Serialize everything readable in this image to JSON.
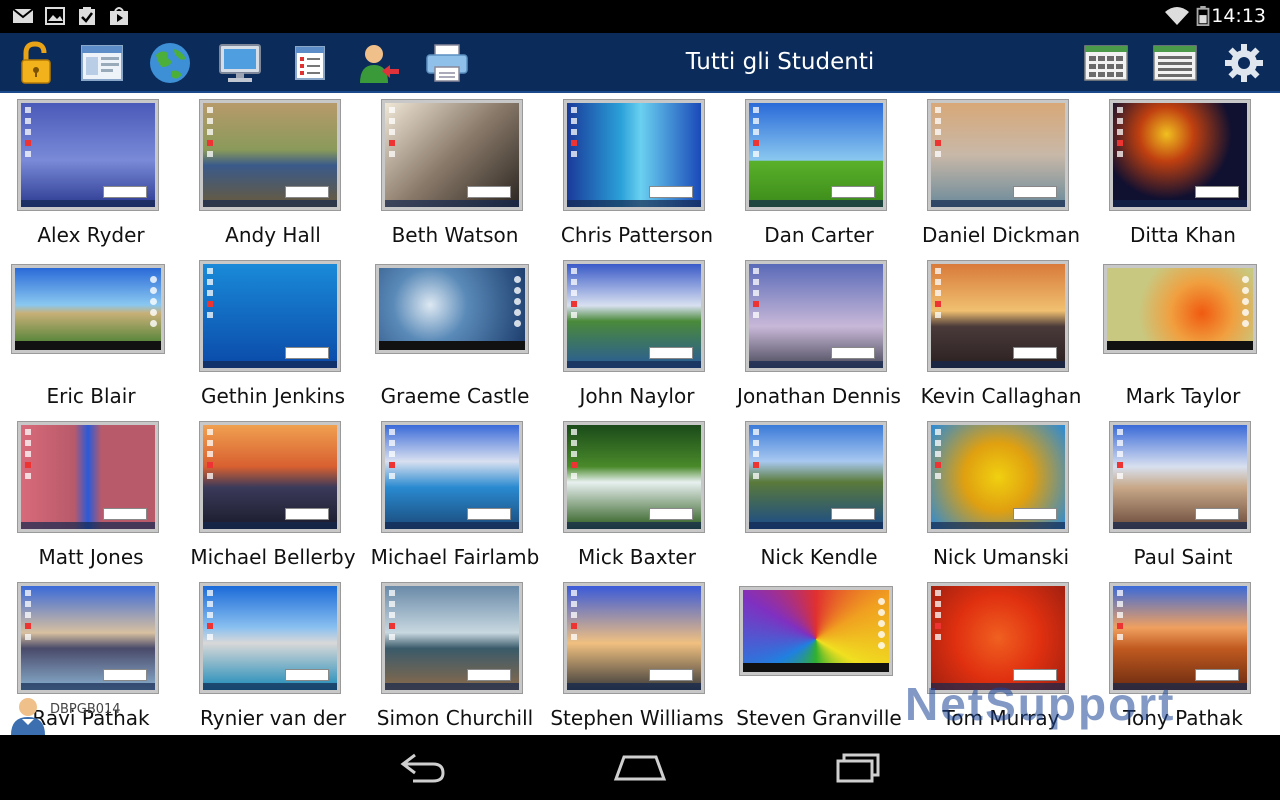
{
  "status_bar": {
    "time": "14:13",
    "icons": [
      "gmail-icon",
      "gallery-icon",
      "clipboard-check-icon",
      "play-store-icon",
      "wifi-icon",
      "battery-icon"
    ]
  },
  "toolbar": {
    "title": "Tutti gli Studenti",
    "left_icons": [
      "lock-icon",
      "browser-window-icon",
      "globe-icon",
      "monitor-icon",
      "checklist-icon",
      "user-remove-icon",
      "printer-icon"
    ],
    "right_icons": [
      "grid-view-icon",
      "list-view-icon",
      "settings-gear-icon"
    ]
  },
  "students": [
    {
      "name": "Alex Ryder"
    },
    {
      "name": "Andy Hall"
    },
    {
      "name": "Beth Watson"
    },
    {
      "name": "Chris Patterson"
    },
    {
      "name": "Dan Carter"
    },
    {
      "name": "Daniel Dickman"
    },
    {
      "name": "Ditta Khan"
    },
    {
      "name": "Eric Blair"
    },
    {
      "name": "Gethin Jenkins"
    },
    {
      "name": "Graeme Castle"
    },
    {
      "name": "John Naylor"
    },
    {
      "name": "Jonathan Dennis"
    },
    {
      "name": "Kevin Callaghan"
    },
    {
      "name": "Mark Taylor"
    },
    {
      "name": "Matt Jones"
    },
    {
      "name": "Michael Bellerby"
    },
    {
      "name": "Michael Fairlamb"
    },
    {
      "name": "Mick Baxter"
    },
    {
      "name": "Nick Kendle"
    },
    {
      "name": "Nick Umanski"
    },
    {
      "name": "Paul Saint"
    },
    {
      "name": "Ravi Pathak"
    },
    {
      "name": "Rynier van der"
    },
    {
      "name": "Simon Churchill"
    },
    {
      "name": "Stephen Williams"
    },
    {
      "name": "Steven Granville"
    },
    {
      "name": "Tom Murray"
    },
    {
      "name": "Tony Pathak"
    }
  ],
  "computer_label": "DBPGB014",
  "watermark": "NetSupport",
  "nav": {
    "icons": [
      "back-icon",
      "home-icon",
      "recent-apps-icon"
    ]
  }
}
